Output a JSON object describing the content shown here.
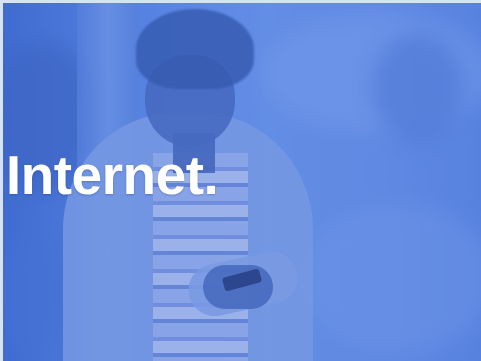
{
  "slide": {
    "headline": "a Internet."
  },
  "colors": {
    "overlay_blue": "#4f7de0",
    "headline_text": "#ffffff",
    "frame_border": "#d7e2f7"
  },
  "background": {
    "image_subject": "woman-looking-at-phone"
  }
}
